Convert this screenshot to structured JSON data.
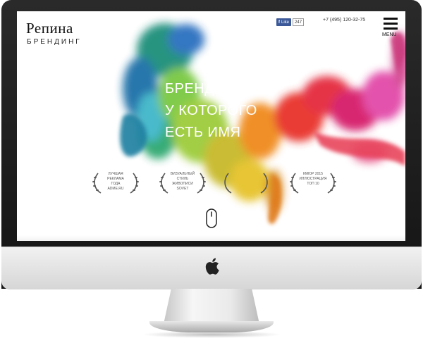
{
  "brand": {
    "name": "Репина",
    "tagline": "БРЕНДИНГ"
  },
  "header": {
    "facebook": {
      "like_label": "Like",
      "count": "247"
    },
    "phone": "+7 (495) 120-32-75",
    "menu_label": "MENU"
  },
  "hero": {
    "headline_lines": [
      "БРЕНДИНГ,",
      "У КОТОРОГО",
      "ЕСТЬ ИМЯ"
    ]
  },
  "awards": [
    {
      "lines": [
        "ЛУЧШАЯ РЕКЛАМА",
        "ГОДА",
        "ADME.RU"
      ]
    },
    {
      "lines": [
        "ВИЗУАЛЬНЫЙ СТИЛЬ",
        "ЖИВОПИСИ",
        "SOVET"
      ]
    },
    {
      "lines": [
        "",
        "",
        ""
      ]
    },
    {
      "lines": [
        "КМЮР 2015",
        "ИЛЛЮСТРАЦИЯ",
        "ТОП 10"
      ]
    }
  ],
  "colors": {
    "fb_blue": "#3b5998",
    "ink_palette": [
      "#1f8f7a",
      "#2b6fbf",
      "#7ac943",
      "#e6c229",
      "#f08a1c",
      "#e8312a",
      "#d61e6b",
      "#e24aa8"
    ]
  },
  "icons": [
    "apple-logo-icon",
    "menu-icon",
    "scroll-mouse-icon",
    "laurel-icon"
  ]
}
